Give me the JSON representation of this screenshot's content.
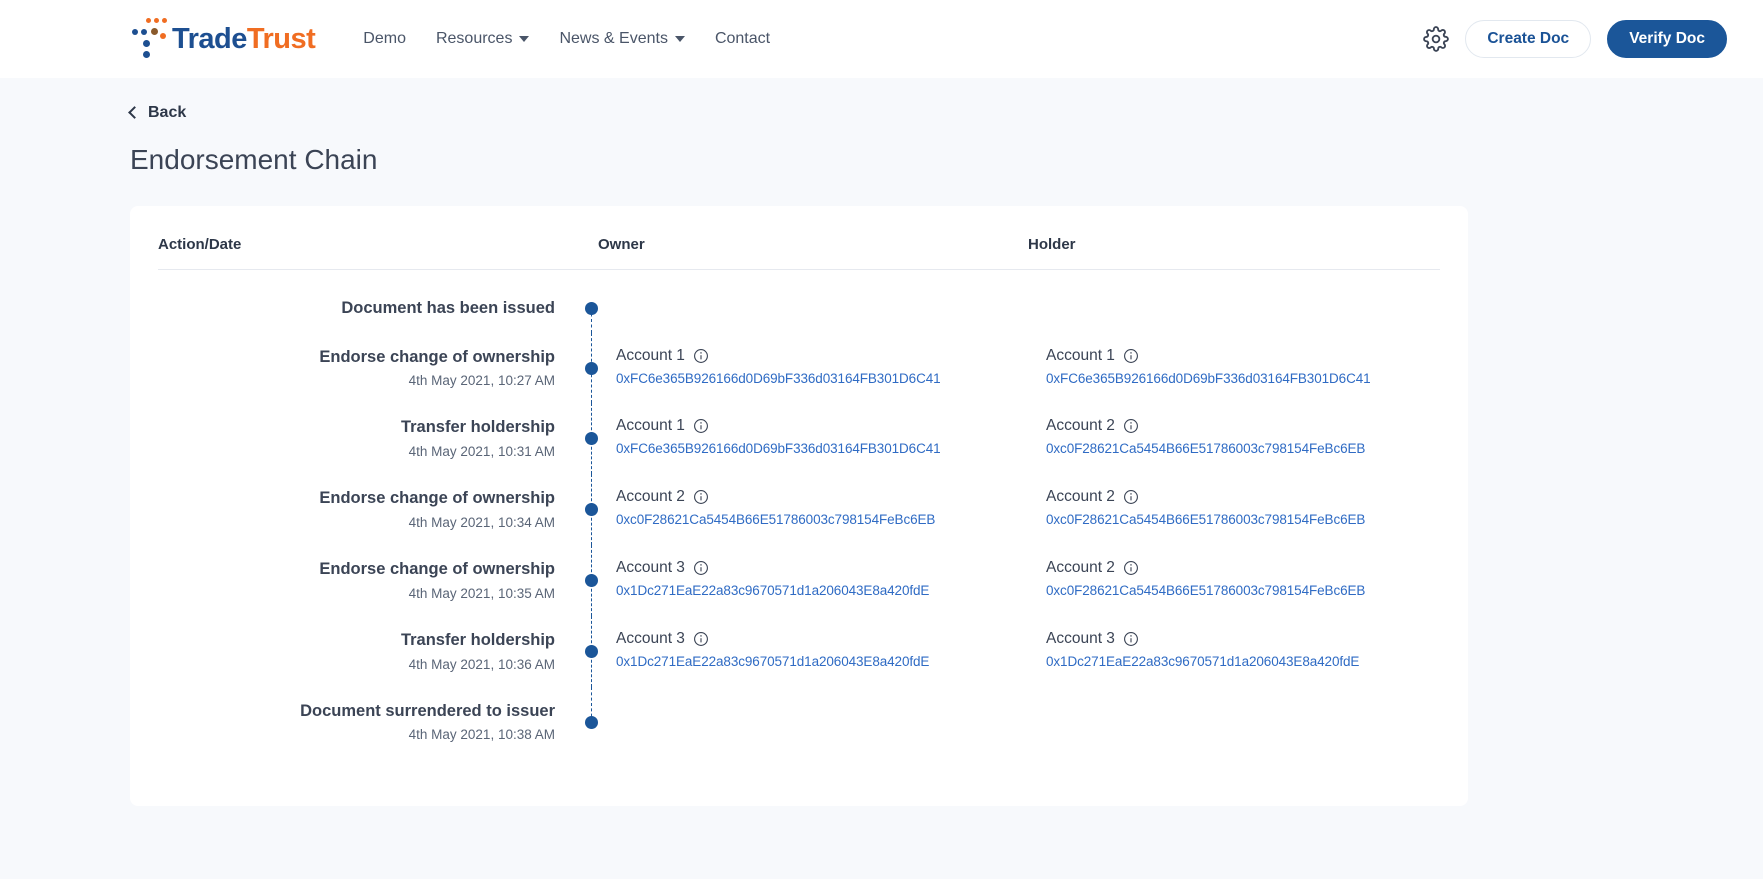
{
  "header": {
    "logo": {
      "text_primary": "Trade",
      "text_accent": "Trust",
      "icon": "tradetrust-dots-logo"
    },
    "nav": [
      {
        "label": "Demo",
        "has_dropdown": false
      },
      {
        "label": "Resources",
        "has_dropdown": true
      },
      {
        "label": "News & Events",
        "has_dropdown": true
      },
      {
        "label": "Contact",
        "has_dropdown": false
      }
    ],
    "settings_icon": "gear-icon",
    "create_doc_label": "Create Doc",
    "verify_doc_label": "Verify Doc"
  },
  "page": {
    "back_label": "Back",
    "title": "Endorsement Chain"
  },
  "table": {
    "headers": {
      "action": "Action/Date",
      "owner": "Owner",
      "holder": "Holder"
    },
    "rows": [
      {
        "action": "Document has been issued",
        "date": "",
        "owner": {
          "name": "",
          "address": ""
        },
        "holder": {
          "name": "",
          "address": ""
        }
      },
      {
        "action": "Endorse change of ownership",
        "date": "4th May 2021, 10:27 AM",
        "owner": {
          "name": "Account 1",
          "address": "0xFC6e365B926166d0D69bF336d03164FB301D6C41"
        },
        "holder": {
          "name": "Account 1",
          "address": "0xFC6e365B926166d0D69bF336d03164FB301D6C41"
        }
      },
      {
        "action": "Transfer holdership",
        "date": "4th May 2021, 10:31 AM",
        "owner": {
          "name": "Account 1",
          "address": "0xFC6e365B926166d0D69bF336d03164FB301D6C41"
        },
        "holder": {
          "name": "Account 2",
          "address": "0xc0F28621Ca5454B66E51786003c798154FeBc6EB"
        }
      },
      {
        "action": "Endorse change of ownership",
        "date": "4th May 2021, 10:34 AM",
        "owner": {
          "name": "Account 2",
          "address": "0xc0F28621Ca5454B66E51786003c798154FeBc6EB"
        },
        "holder": {
          "name": "Account 2",
          "address": "0xc0F28621Ca5454B66E51786003c798154FeBc6EB"
        }
      },
      {
        "action": "Endorse change of ownership",
        "date": "4th May 2021, 10:35 AM",
        "owner": {
          "name": "Account 3",
          "address": "0x1Dc271EaE22a83c9670571d1a206043E8a420fdE"
        },
        "holder": {
          "name": "Account 2",
          "address": "0xc0F28621Ca5454B66E51786003c798154FeBc6EB"
        }
      },
      {
        "action": "Transfer holdership",
        "date": "4th May 2021, 10:36 AM",
        "owner": {
          "name": "Account 3",
          "address": "0x1Dc271EaE22a83c9670571d1a206043E8a420fdE"
        },
        "holder": {
          "name": "Account 3",
          "address": "0x1Dc271EaE22a83c9670571d1a206043E8a420fdE"
        }
      },
      {
        "action": "Document surrendered to issuer",
        "date": "4th May 2021, 10:38 AM",
        "owner": {
          "name": "",
          "address": ""
        },
        "holder": {
          "name": "",
          "address": ""
        }
      }
    ],
    "info_icon": "info-circle-icon"
  },
  "colors": {
    "brand_navy": "#1b5699",
    "brand_orange": "#f06d22",
    "link_blue": "#2f6bc4",
    "page_bg": "#f7f9fc",
    "text_dark": "#3b4455"
  }
}
